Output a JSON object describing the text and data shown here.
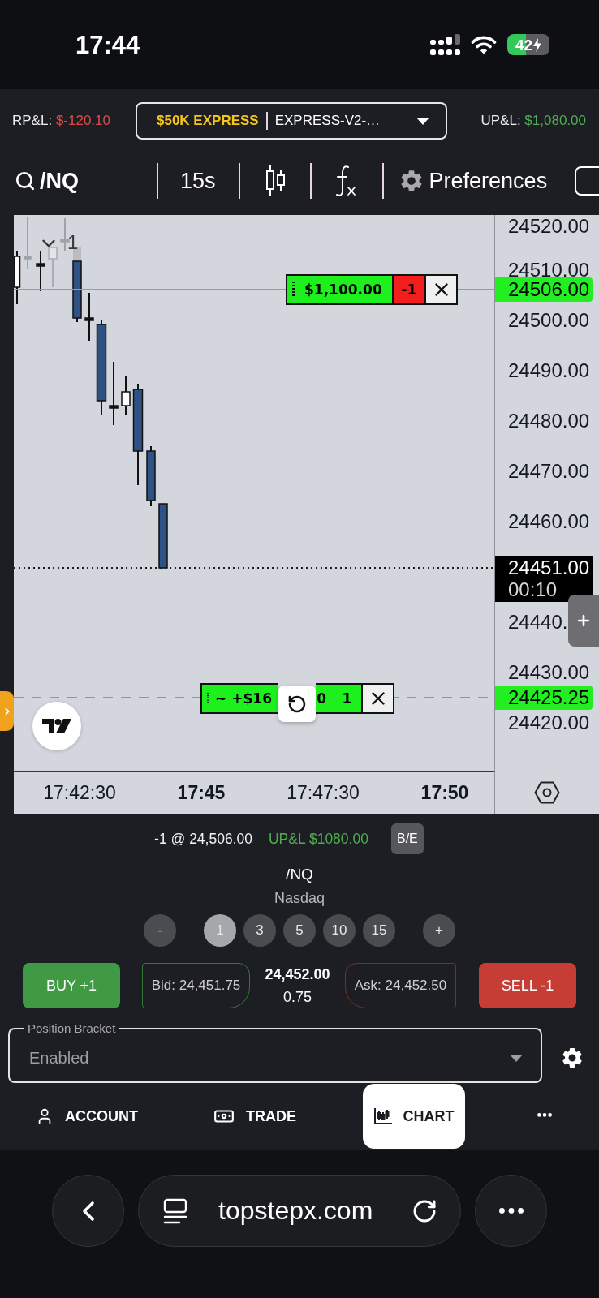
{
  "status_bar": {
    "time": "17:44",
    "battery": "42"
  },
  "header": {
    "realized_pnl": {
      "label": "RP&L:",
      "value": "$-120.10"
    },
    "account": {
      "name": "$50K EXPRESS",
      "id": "EXPRESS-V2-…"
    },
    "unrealized_pnl": {
      "label": "UP&L:",
      "value": "$1,080.00"
    }
  },
  "toolbar": {
    "symbol": "/NQ",
    "interval": "15s",
    "preferences": "Preferences"
  },
  "chart": {
    "legend_count": "1",
    "position_line": {
      "pnl": "$1,100.00",
      "quantity": "-1",
      "price": "24506.00"
    },
    "last_price": {
      "price": "24451.00",
      "countdown": "00:10"
    },
    "target_line": {
      "pnl_start": "~ +$16",
      "pnl_end": "0",
      "quantity": "1",
      "price": "24425.25"
    },
    "price_ticks": [
      "24520.00",
      "24510.00",
      "24500.00",
      "24490.00",
      "24480.00",
      "24470.00",
      "24460.00",
      "24440.",
      "24430.00",
      "24420.00"
    ],
    "time_ticks": [
      {
        "label": "17:42:30",
        "major": false
      },
      {
        "label": "17:45",
        "major": true
      },
      {
        "label": "17:47:30",
        "major": false
      },
      {
        "label": "17:50",
        "major": true
      }
    ]
  },
  "order_panel": {
    "position": "-1 @ 24,506.00",
    "unrealized_pnl": "UP&L $1080.00",
    "breakeven_button": "B/E",
    "symbol": "/NQ",
    "exchange": "Nasdaq",
    "quantity": {
      "decrease": "-",
      "increase": "+",
      "options": [
        {
          "label": "1",
          "selected": true
        },
        {
          "label": "3",
          "selected": false
        },
        {
          "label": "5",
          "selected": false
        },
        {
          "label": "10",
          "selected": false
        },
        {
          "label": "15",
          "selected": false
        }
      ]
    },
    "buy_button": "BUY +1",
    "bid": "Bid: 24,451.75",
    "last_price": "24,452.00",
    "spread": "0.75",
    "ask": "Ask: 24,452.50",
    "sell_button": "SELL -1",
    "position_bracket": {
      "label": "Position Bracket",
      "value": "Enabled"
    }
  },
  "nav": [
    {
      "kind": "account",
      "label": "ACCOUNT",
      "selected": false
    },
    {
      "kind": "trade",
      "label": "TRADE",
      "selected": false
    },
    {
      "kind": "chart",
      "label": "CHART",
      "selected": true
    }
  ],
  "browser_bar": {
    "url": "topstepx.com"
  }
}
